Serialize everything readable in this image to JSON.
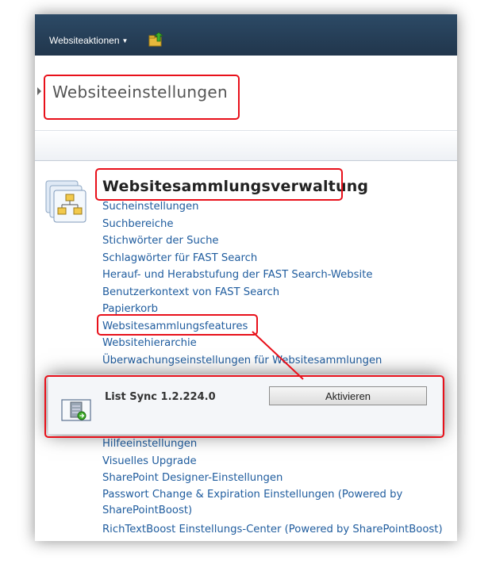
{
  "ribbon": {
    "site_actions_label": "Websiteaktionen",
    "background": "#233a52"
  },
  "page": {
    "title": "Websiteeinstellungen"
  },
  "section": {
    "heading": "Websitesammlungsverwaltung",
    "links_top": [
      "Sucheinstellungen",
      "Suchbereiche",
      "Stichwörter der Suche",
      "Schlagwörter für FAST Search",
      "Herauf- und Herabstufung der FAST Search-Website",
      "Benutzerkontext von FAST Search",
      "Papierkorb",
      "Websitesammlungsfeatures",
      "Websitehierarchie",
      "Überwachungseinstellungen für Websitesammlungen"
    ],
    "links_bottom": [
      "Hilfeeinstellungen",
      "Visuelles Upgrade",
      "SharePoint Designer-Einstellungen",
      "Passwort Change & Expiration Einstellungen (Powered by SharePointBoost)",
      "RichTextBoost Einstellungs-Center (Powered by SharePointBoost)"
    ]
  },
  "feature": {
    "name": "List Sync 1.2.224.0",
    "activate_label": "Aktivieren"
  },
  "colors": {
    "link": "#1f5c9e",
    "highlight": "#e8101a"
  }
}
